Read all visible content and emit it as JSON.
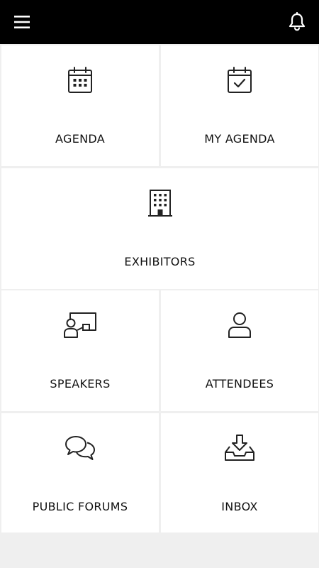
{
  "header": {
    "menu_icon": "hamburger-menu-icon",
    "notifications_icon": "bell-icon",
    "background": "#000000"
  },
  "tiles": [
    {
      "label": "AGENDA",
      "icon": "calendar-grid-icon"
    },
    {
      "label": "MY AGENDA",
      "icon": "calendar-check-icon"
    },
    {
      "label": "EXHIBITORS",
      "icon": "building-icon"
    },
    {
      "label": "SPEAKERS",
      "icon": "presenter-board-icon"
    },
    {
      "label": "ATTENDEES",
      "icon": "person-icon"
    },
    {
      "label": "PUBLIC FORUMS",
      "icon": "chat-bubbles-icon"
    },
    {
      "label": "INBOX",
      "icon": "inbox-download-icon"
    }
  ]
}
